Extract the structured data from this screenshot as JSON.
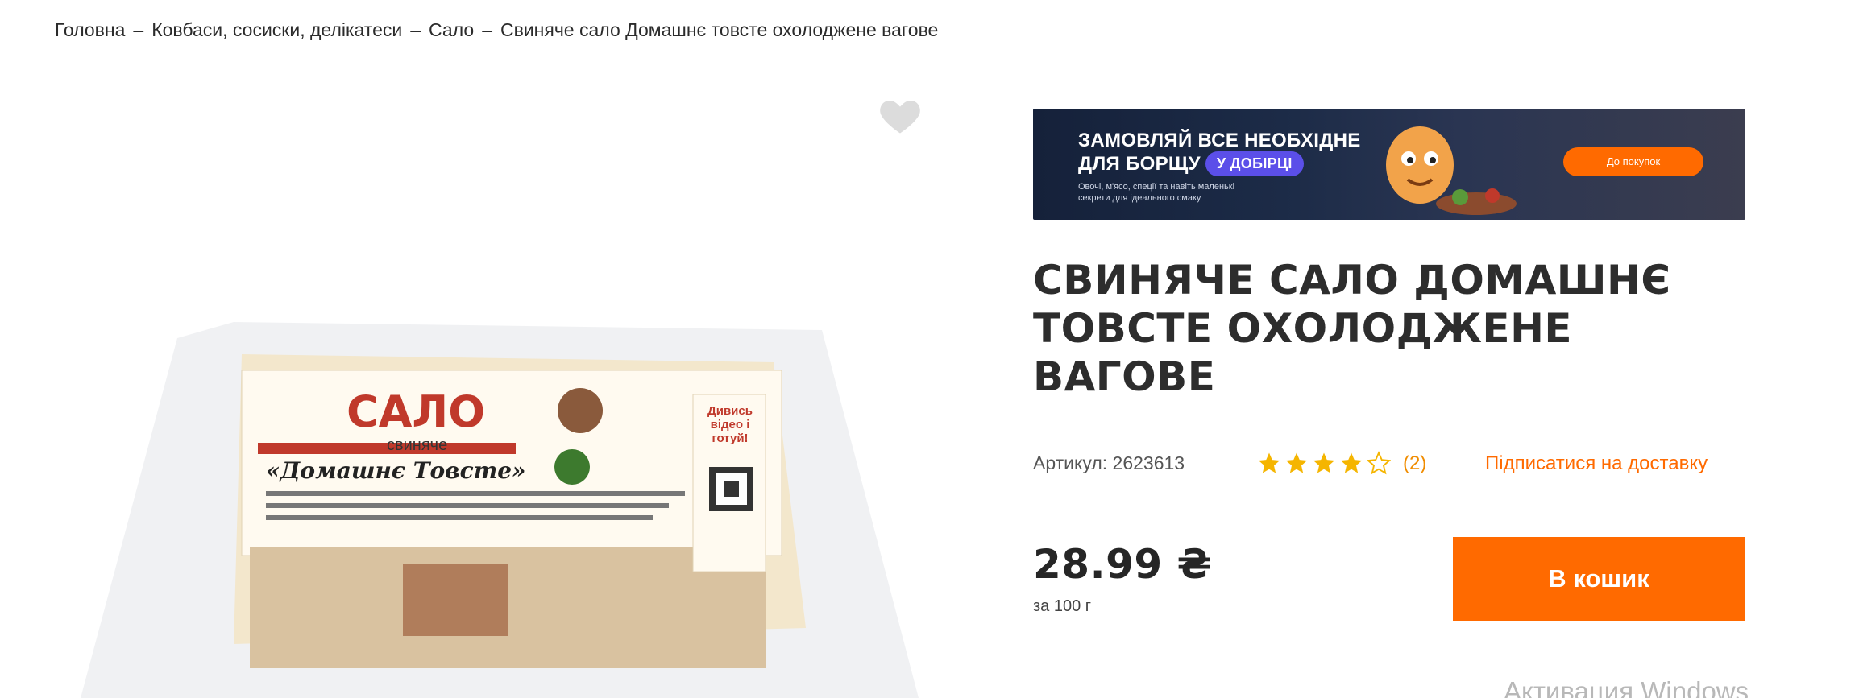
{
  "breadcrumb": {
    "items": [
      "Головна",
      "Ковбаси, сосиски, делікатеси",
      "Сало",
      "Свиняче сало Домашнє товсте охолоджене вагове"
    ],
    "separator": "–"
  },
  "banner": {
    "line1": "ЗАМОВЛЯЙ ВСЕ НЕОБХІДНЕ",
    "line2": "ДЛЯ БОРЩУ",
    "pill": "У ДОБІРЦІ",
    "subtext": "Овочі, м'ясо, спеції та навіть маленькі секрети для ідеального смаку",
    "cta": "До покупок"
  },
  "product": {
    "title": "СВИНЯЧЕ САЛО ДОМАШНЄ ТОВСТЕ ОХОЛОДЖЕНЕ ВАГОВЕ",
    "sku_label": "Артикул: 2623613",
    "rating": 4,
    "rating_max": 5,
    "reviews": "(2)",
    "subscribe": "Підписатися на доставку",
    "price": "28.99 ₴",
    "unit": "за 100 г",
    "add_to_cart": "В кошик",
    "image_icon": "product-photo"
  },
  "package": {
    "brand": "САЛО",
    "sub": "свиняче",
    "name": "«Домашнє Товсте»",
    "side": "Дивись відео і готуй!"
  },
  "colors": {
    "accent": "#ff6a00",
    "star": "#f5b500",
    "title": "#2d2d2d"
  },
  "system": {
    "watermark": "Активация Windows"
  }
}
